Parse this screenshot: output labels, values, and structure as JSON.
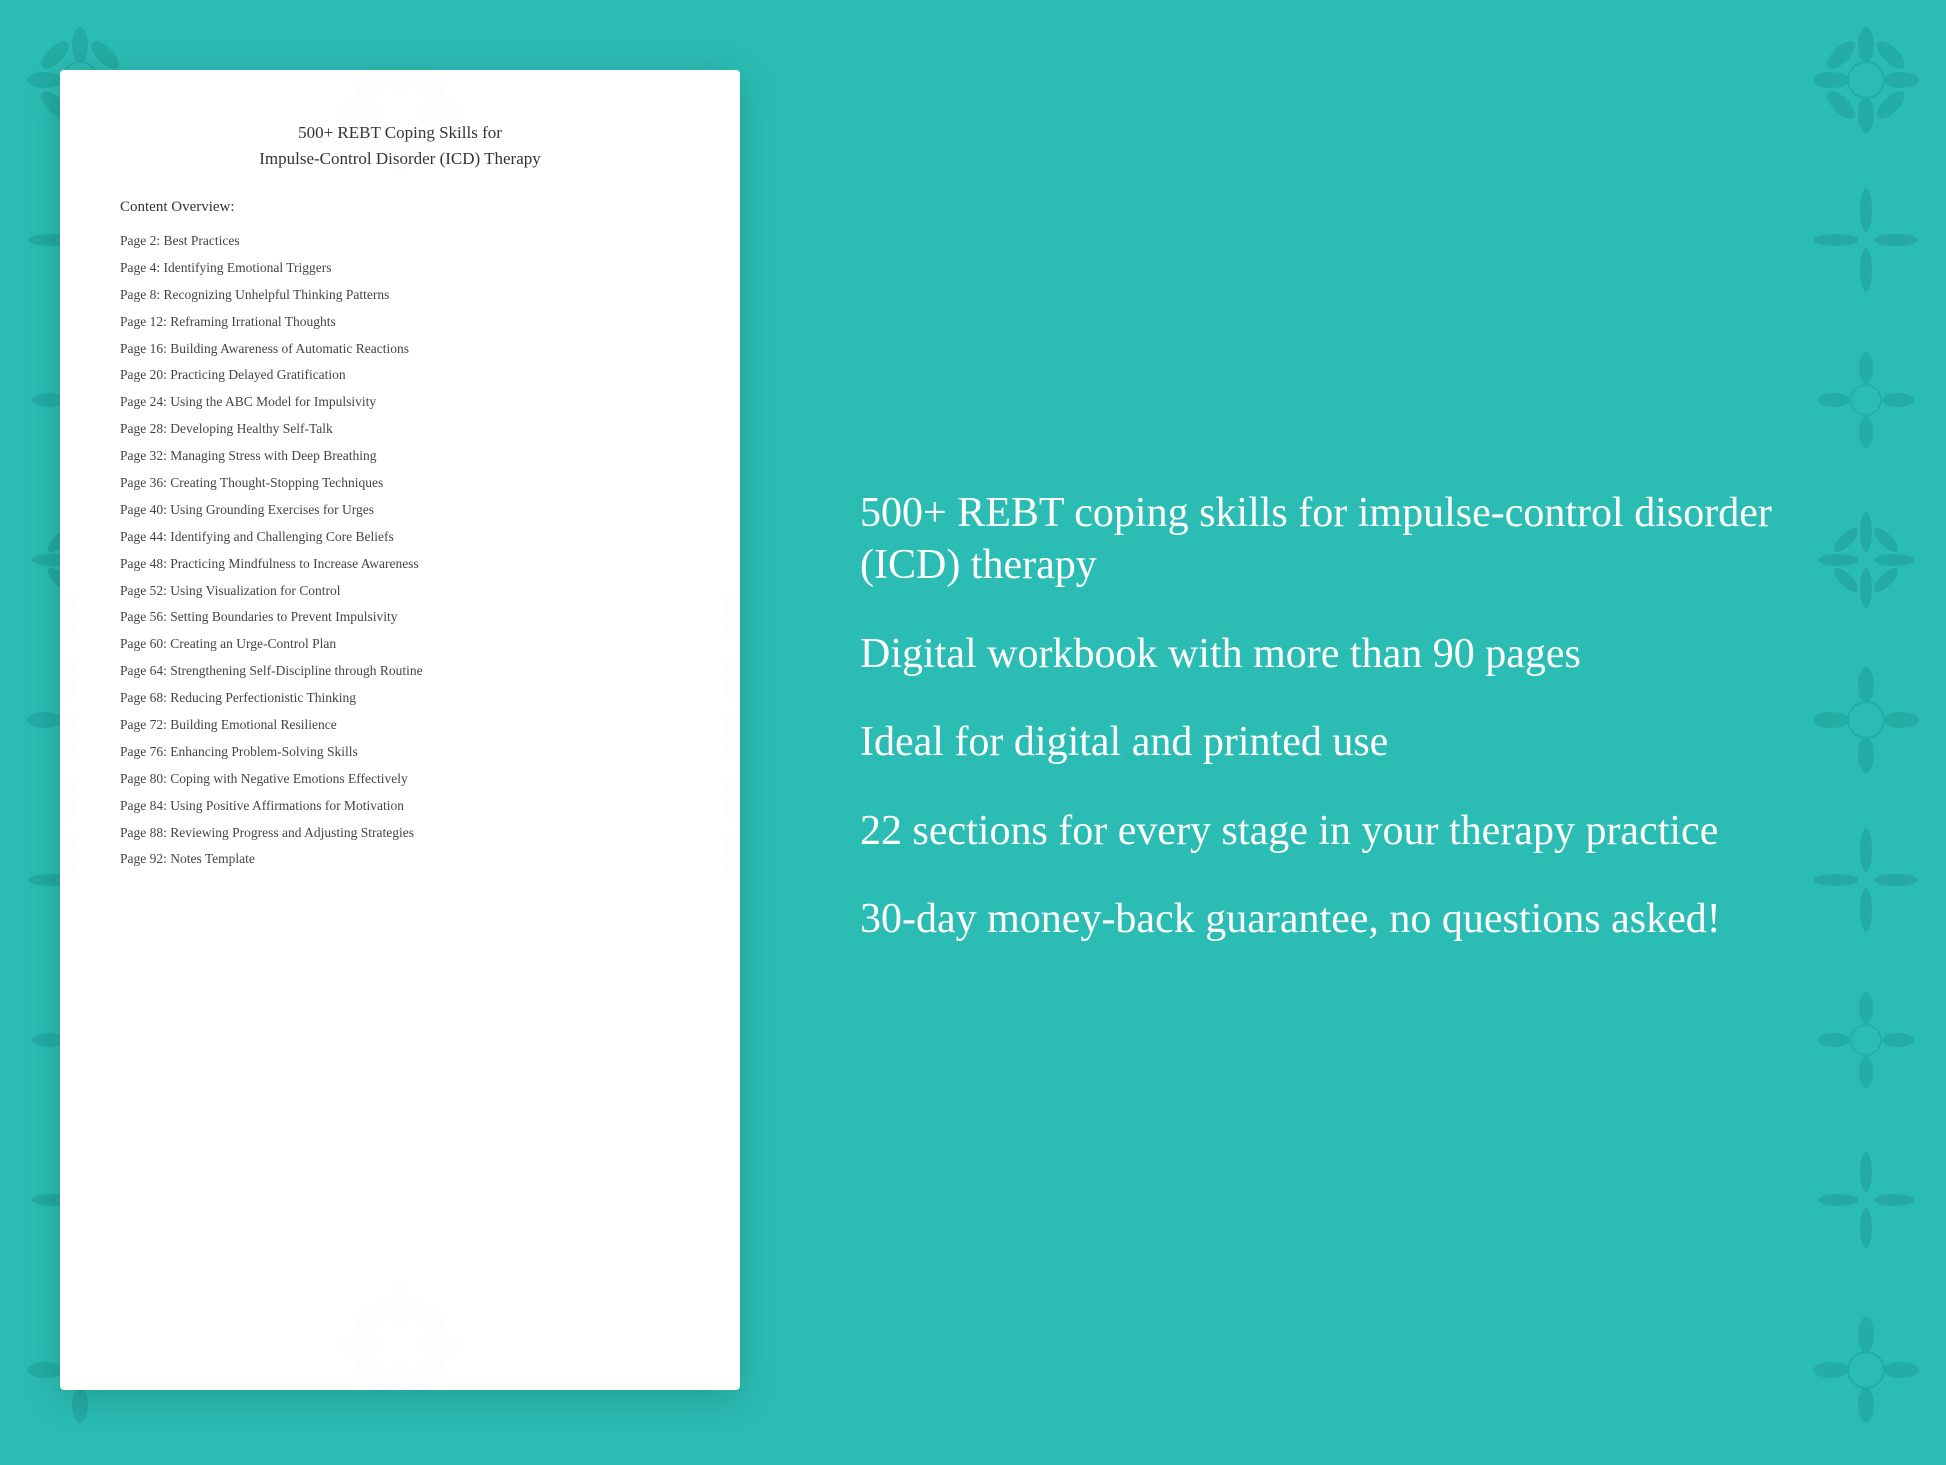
{
  "background_color": "#2bbdb4",
  "document": {
    "title_line1": "500+ REBT Coping Skills for",
    "title_line2": "Impulse-Control Disorder (ICD) Therapy",
    "content_heading": "Content Overview:",
    "toc_items": [
      {
        "page": "Page  2:",
        "title": "Best Practices"
      },
      {
        "page": "Page  4:",
        "title": "Identifying Emotional Triggers"
      },
      {
        "page": "Page  8:",
        "title": "Recognizing Unhelpful Thinking Patterns"
      },
      {
        "page": "Page 12:",
        "title": "Reframing Irrational Thoughts"
      },
      {
        "page": "Page 16:",
        "title": "Building Awareness of Automatic Reactions"
      },
      {
        "page": "Page 20:",
        "title": "Practicing Delayed Gratification"
      },
      {
        "page": "Page 24:",
        "title": "Using the ABC Model for Impulsivity"
      },
      {
        "page": "Page 28:",
        "title": "Developing Healthy Self-Talk"
      },
      {
        "page": "Page 32:",
        "title": "Managing Stress with Deep Breathing"
      },
      {
        "page": "Page 36:",
        "title": "Creating Thought-Stopping Techniques"
      },
      {
        "page": "Page 40:",
        "title": "Using Grounding Exercises for Urges"
      },
      {
        "page": "Page 44:",
        "title": "Identifying and Challenging Core Beliefs"
      },
      {
        "page": "Page 48:",
        "title": "Practicing Mindfulness to Increase Awareness"
      },
      {
        "page": "Page 52:",
        "title": "Using Visualization for Control"
      },
      {
        "page": "Page 56:",
        "title": "Setting Boundaries to Prevent Impulsivity"
      },
      {
        "page": "Page 60:",
        "title": "Creating an Urge-Control Plan"
      },
      {
        "page": "Page 64:",
        "title": "Strengthening Self-Discipline through Routine"
      },
      {
        "page": "Page 68:",
        "title": "Reducing Perfectionistic Thinking"
      },
      {
        "page": "Page 72:",
        "title": "Building Emotional Resilience"
      },
      {
        "page": "Page 76:",
        "title": "Enhancing Problem-Solving Skills"
      },
      {
        "page": "Page 80:",
        "title": "Coping with Negative Emotions Effectively"
      },
      {
        "page": "Page 84:",
        "title": "Using Positive Affirmations for Motivation"
      },
      {
        "page": "Page 88:",
        "title": "Reviewing Progress and Adjusting Strategies"
      },
      {
        "page": "Page 92:",
        "title": "Notes Template"
      }
    ]
  },
  "marketing": {
    "points": [
      "500+ REBT coping skills for impulse-control disorder (ICD) therapy",
      "Digital workbook with more than 90 pages",
      "Ideal for digital and printed use",
      "22 sections for every stage in your therapy practice",
      "30-day money-back guarantee, no questions asked!"
    ]
  }
}
